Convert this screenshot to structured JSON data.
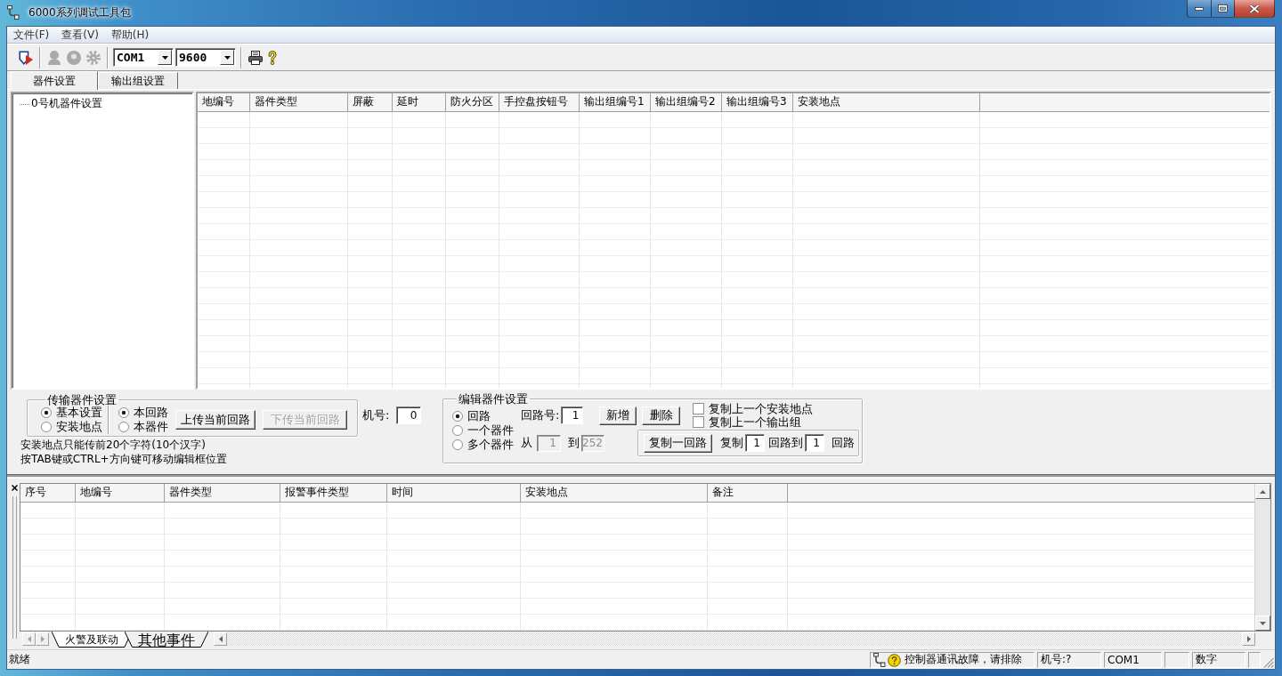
{
  "window": {
    "title": "6000系列调试工具包"
  },
  "menu": [
    {
      "label": "文件(F)"
    },
    {
      "label": "查看(V)"
    },
    {
      "label": "帮助(H)"
    }
  ],
  "toolbar": {
    "groups": [
      {
        "items": [
          {
            "kind": "connect",
            "disabled": false
          }
        ]
      },
      {
        "items": [
          {
            "kind": "figure",
            "disabled": true
          },
          {
            "kind": "disc",
            "disabled": true
          },
          {
            "kind": "gear",
            "disabled": true
          }
        ]
      },
      {
        "items": [
          {
            "kind": "combo",
            "value": "COM1"
          },
          {
            "kind": "combo",
            "value": "9600"
          }
        ]
      },
      {
        "items": [
          {
            "kind": "print",
            "disabled": false
          },
          {
            "kind": "help",
            "disabled": false
          }
        ]
      }
    ]
  },
  "tabs": [
    {
      "label": "器件设置",
      "selected": true
    },
    {
      "label": "输出组设置",
      "selected": false
    }
  ],
  "tree": [
    {
      "label": "0号机器件设置"
    }
  ],
  "device_table": {
    "columns": [
      "地编号",
      "器件类型",
      "屏蔽",
      "延时",
      "防火分区",
      "手控盘按钮号",
      "输出组编号1",
      "输出组编号2",
      "输出组编号3",
      "安装地点"
    ]
  },
  "transfer_settings": {
    "title": "传输器件设置",
    "modes": [
      {
        "label": "基本设置",
        "selected": true
      },
      {
        "label": "安装地点",
        "selected": false
      }
    ],
    "scopes": [
      {
        "label": "本回路",
        "selected": true
      },
      {
        "label": "本器件",
        "selected": false
      }
    ],
    "buttons": [
      {
        "label": "上传当前回路",
        "disabled": false
      },
      {
        "label": "下传当前回路",
        "disabled": true
      }
    ]
  },
  "machine_number": {
    "label": "机号:",
    "value": "0"
  },
  "hints": [
    "安装地点只能传前20个字符(10个汉字)",
    "按TAB键或CTRL+方向键可移动编辑框位置"
  ],
  "edit_settings": {
    "title": "编辑器件设置",
    "modes": [
      {
        "label": "回路",
        "selected": true
      },
      {
        "label": "一个器件",
        "selected": false
      },
      {
        "label": "多个器件",
        "selected": false
      }
    ],
    "loop_number": {
      "label": "回路号:",
      "value": "1"
    },
    "buttons": [
      {
        "label": "新增"
      },
      {
        "label": "删除"
      }
    ],
    "options": [
      {
        "label": "复制上一个安装地点",
        "checked": false
      },
      {
        "label": "复制上一个输出组",
        "checked": false
      }
    ],
    "range": {
      "from_label": "从",
      "from": "1",
      "to_label": "到",
      "to": "252",
      "disabled": true
    },
    "copy_loop": {
      "button": "复制一回路",
      "copy_label": "复制",
      "source": "1",
      "middle_label": "回路到",
      "target": "1",
      "end_label": "回路"
    }
  },
  "event_log": {
    "columns": [
      "序号",
      "地编号",
      "器件类型",
      "报警事件类型",
      "时间",
      "安装地点",
      "备注"
    ],
    "tabs": [
      {
        "label": "火警及联动",
        "selected": true
      },
      {
        "label": "其他事件",
        "selected": false
      }
    ]
  },
  "status_bar": {
    "message": "就绪",
    "panes": [
      {
        "kind": "alert",
        "text": "控制器通讯故障，请排除"
      },
      {
        "kind": "text",
        "text": "机号:?"
      },
      {
        "kind": "text",
        "text": "COM1"
      },
      {
        "kind": "empty"
      },
      {
        "kind": "text",
        "text": "数字"
      },
      {
        "kind": "empty"
      }
    ]
  }
}
